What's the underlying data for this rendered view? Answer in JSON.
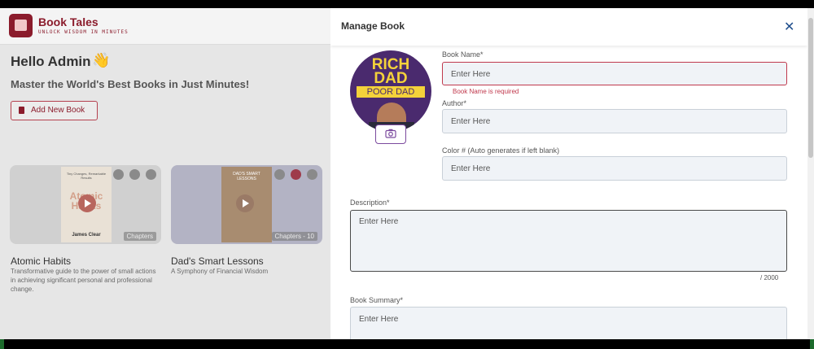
{
  "app": {
    "brand": "Book Tales",
    "tagline": "UNLOCK WISDOM IN MINUTES",
    "greeting": "Hello Admin",
    "wave_emoji": "👋",
    "subtitle": "Master the World's Best Books in Just Minutes!",
    "add_book_label": "Add New Book",
    "cards": [
      {
        "title": "Atomic Habits",
        "description": "Transformative guide to the power of small actions in achieving significant personal and professional change.",
        "cover_title": "Atomic Habits",
        "cover_subtitle": "Tiny Changes, Remarkable Results",
        "cover_author": "James Clear",
        "chapters": "Chapters"
      },
      {
        "title": "Dad's Smart Lessons",
        "description": "A Symphony of Financial Wisdom",
        "cover_title": "DAD'S SMART LESSONS",
        "chapters": "Chapters - 10"
      }
    ]
  },
  "modal": {
    "title": "Manage Book",
    "close_icon": "close-icon",
    "cover": {
      "line1": "RICH",
      "line2": "DAD",
      "line3": "POOR DAD"
    },
    "fields": {
      "book_name": {
        "label": "Book Name*",
        "placeholder": "Enter Here",
        "error": "Book Name is required"
      },
      "author": {
        "label": "Author*",
        "placeholder": "Enter Here"
      },
      "color": {
        "label": "Color # (Auto generates if left blank)",
        "placeholder": "Enter Here"
      },
      "description": {
        "label": "Description*",
        "placeholder": "Enter Here",
        "counter": "/ 2000"
      },
      "summary": {
        "label": "Book Summary*",
        "placeholder": "Enter Here"
      }
    }
  },
  "colors": {
    "brand": "#8b1c2c",
    "error": "#c0394d",
    "accent_purple": "#7b4a9e",
    "close_blue": "#1f4e8c"
  }
}
